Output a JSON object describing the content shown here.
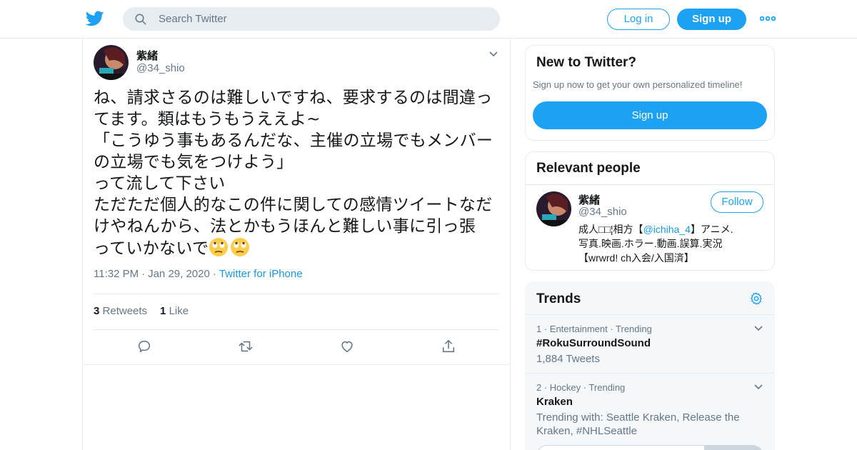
{
  "header": {
    "logo_icon": "twitter-bird-icon",
    "search_placeholder": "Search Twitter",
    "login_label": "Log in",
    "signup_label": "Sign up",
    "more_icon": "more-dots-icon"
  },
  "tweet": {
    "author_name": "紫緒",
    "author_handle": "@34_shio",
    "text_lines": [
      "ね、請求さるのは難しいですね、要求するのは間違っ",
      "てます。類はもうもうええよ~",
      "「こうゆう事もあるんだな、主催の立場でもメンバー",
      "の立場でも気をつけよう」",
      "って流して下さい",
      "ただただ個人的なこの件に関しての感情ツイートなだ",
      "けやねんから、法とかもうほんと難しい事に引っ張",
      "っていかないで"
    ],
    "emoji_icon": "eye-roll-emoji-icon",
    "time": "11:32 PM",
    "date": "Jan 29, 2020",
    "source": "Twitter for iPhone",
    "retweet_count": "3",
    "retweet_label": "Retweets",
    "like_count": "1",
    "like_label": "Like",
    "actions": [
      "reply-icon",
      "retweet-icon",
      "like-icon",
      "share-icon"
    ]
  },
  "new_to_twitter": {
    "title": "New to Twitter?",
    "subtitle": "Sign up now to get your own personalized timeline!",
    "button_label": "Sign up"
  },
  "relevant_people": {
    "title": "Relevant people",
    "name": "紫緒",
    "handle": "@34_shio",
    "follow_label": "Follow",
    "bio_line1_prefix": "成人□□¦相方【",
    "bio_mention": "@ichiha_4",
    "bio_line1_suffix": "】アニメ.",
    "bio_line2": "写真.映画.ホラー.動画.誤算.実況",
    "bio_line3": "【wrwrd! ch入会/入国済】"
  },
  "trends": {
    "title": "Trends",
    "settings_icon": "gear-icon",
    "items": [
      {
        "meta": "1 · Entertainment · Trending",
        "name": "#RokuSurroundSound",
        "count": "1,884 Tweets"
      },
      {
        "meta": "2 · Hockey · Trending",
        "name": "Kraken",
        "count": "Trending with: Seattle Kraken, Release the Kraken, #NHLSeattle"
      }
    ]
  },
  "colors": {
    "accent": "#1da1f2",
    "link": "#1b95e0",
    "secondary_text": "#657786",
    "border": "#e6ecf0",
    "trends_bg": "#f5f8fa"
  }
}
